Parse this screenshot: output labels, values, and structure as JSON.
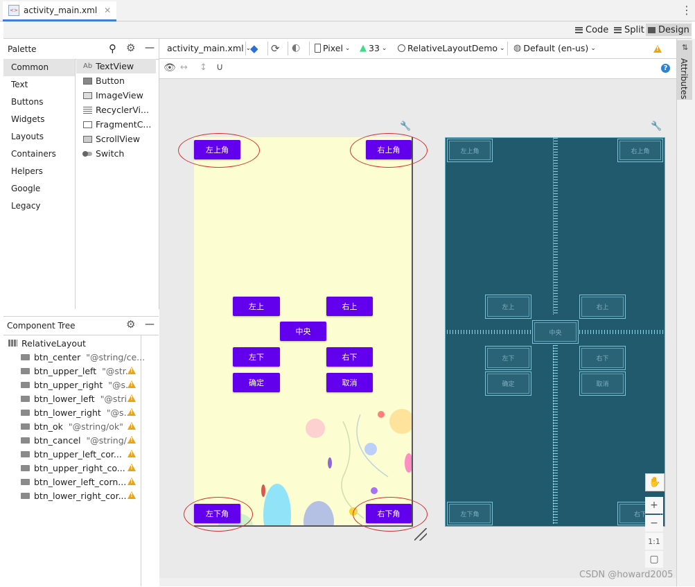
{
  "tab": {
    "title": "activity_main.xml"
  },
  "modes": {
    "code": "Code",
    "split": "Split",
    "design": "Design"
  },
  "palette": {
    "title": "Palette",
    "categories": [
      "Common",
      "Text",
      "Buttons",
      "Widgets",
      "Layouts",
      "Containers",
      "Helpers",
      "Google",
      "Legacy"
    ],
    "items": [
      "TextView",
      "Button",
      "ImageView",
      "RecyclerVi...",
      "FragmentC...",
      "ScrollView",
      "Switch"
    ],
    "textview_prefix": "Ab"
  },
  "tree": {
    "title": "Component Tree",
    "root": "RelativeLayout",
    "rows": [
      {
        "name": "btn_center",
        "attr": "\"@string/ce...",
        "warn": false
      },
      {
        "name": "btn_upper_left",
        "attr": "\"@str...",
        "warn": true
      },
      {
        "name": "btn_upper_right",
        "attr": "\"@s...",
        "warn": true
      },
      {
        "name": "btn_lower_left",
        "attr": "\"@stri...",
        "warn": true
      },
      {
        "name": "btn_lower_right",
        "attr": "\"@s...",
        "warn": true
      },
      {
        "name": "btn_ok",
        "attr": "\"@string/ok\"",
        "warn": true
      },
      {
        "name": "btn_cancel",
        "attr": "\"@string/...",
        "warn": true
      },
      {
        "name": "btn_upper_left_cor...",
        "attr": "",
        "warn": true
      },
      {
        "name": "btn_upper_right_co...",
        "attr": "",
        "warn": true
      },
      {
        "name": "btn_lower_left_corn...",
        "attr": "",
        "warn": true
      },
      {
        "name": "btn_lower_right_cor...",
        "attr": "",
        "warn": true
      }
    ]
  },
  "toolbar": {
    "file": "activity_main.xml",
    "device": "Pixel",
    "api": "33",
    "theme": "RelativeLayoutDemo",
    "locale": "Default (en-us)"
  },
  "attributes_tab": "Attributes",
  "buttons": {
    "upper_left_corner": "左上角",
    "upper_right_corner": "右上角",
    "upper_left": "左上",
    "upper_right": "右上",
    "center": "中央",
    "lower_left": "左下",
    "lower_right": "右下",
    "ok": "确定",
    "cancel": "取消",
    "lower_left_corner": "左下角",
    "lower_right_corner": "右下角"
  },
  "blueprint_lower_right_corner": "右下",
  "zoom": {
    "fit": "1:1"
  },
  "colors": {
    "button": "#6200ee",
    "phone_bg": "#fdfdd2",
    "blueprint": "#215a6d",
    "highlight_oval": "#d43030"
  },
  "watermark": "CSDN @howard2005"
}
